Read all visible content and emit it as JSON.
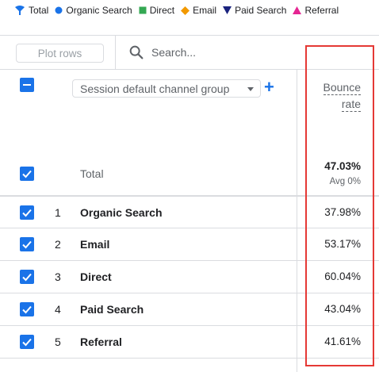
{
  "legend": [
    {
      "label": "Total",
      "icon": "total-marker-icon",
      "color": "#1a73e8"
    },
    {
      "label": "Organic Search",
      "icon": "circle-icon",
      "color": "#1a73e8"
    },
    {
      "label": "Direct",
      "icon": "square-icon",
      "color": "#34a853"
    },
    {
      "label": "Email",
      "icon": "diamond-icon",
      "color": "#f29900"
    },
    {
      "label": "Paid Search",
      "icon": "triangle-down-icon",
      "color": "#1a237e"
    },
    {
      "label": "Referral",
      "icon": "triangle-up-icon",
      "color": "#e52592"
    }
  ],
  "toolbar": {
    "plot_rows_label": "Plot rows",
    "search_placeholder": "Search..."
  },
  "table": {
    "dimension_label": "Session default channel group",
    "metric_header_line1": "Bounce",
    "metric_header_line2": "rate",
    "total": {
      "label": "Total",
      "value": "47.03%",
      "sub": "Avg 0%"
    },
    "rows": [
      {
        "index": "1",
        "name": "Organic Search",
        "value": "37.98%"
      },
      {
        "index": "2",
        "name": "Email",
        "value": "53.17%"
      },
      {
        "index": "3",
        "name": "Direct",
        "value": "60.04%"
      },
      {
        "index": "4",
        "name": "Paid Search",
        "value": "43.04%"
      },
      {
        "index": "5",
        "name": "Referral",
        "value": "41.61%"
      }
    ]
  },
  "colors": {
    "accent": "#1a73e8",
    "highlight_border": "#e53935"
  }
}
